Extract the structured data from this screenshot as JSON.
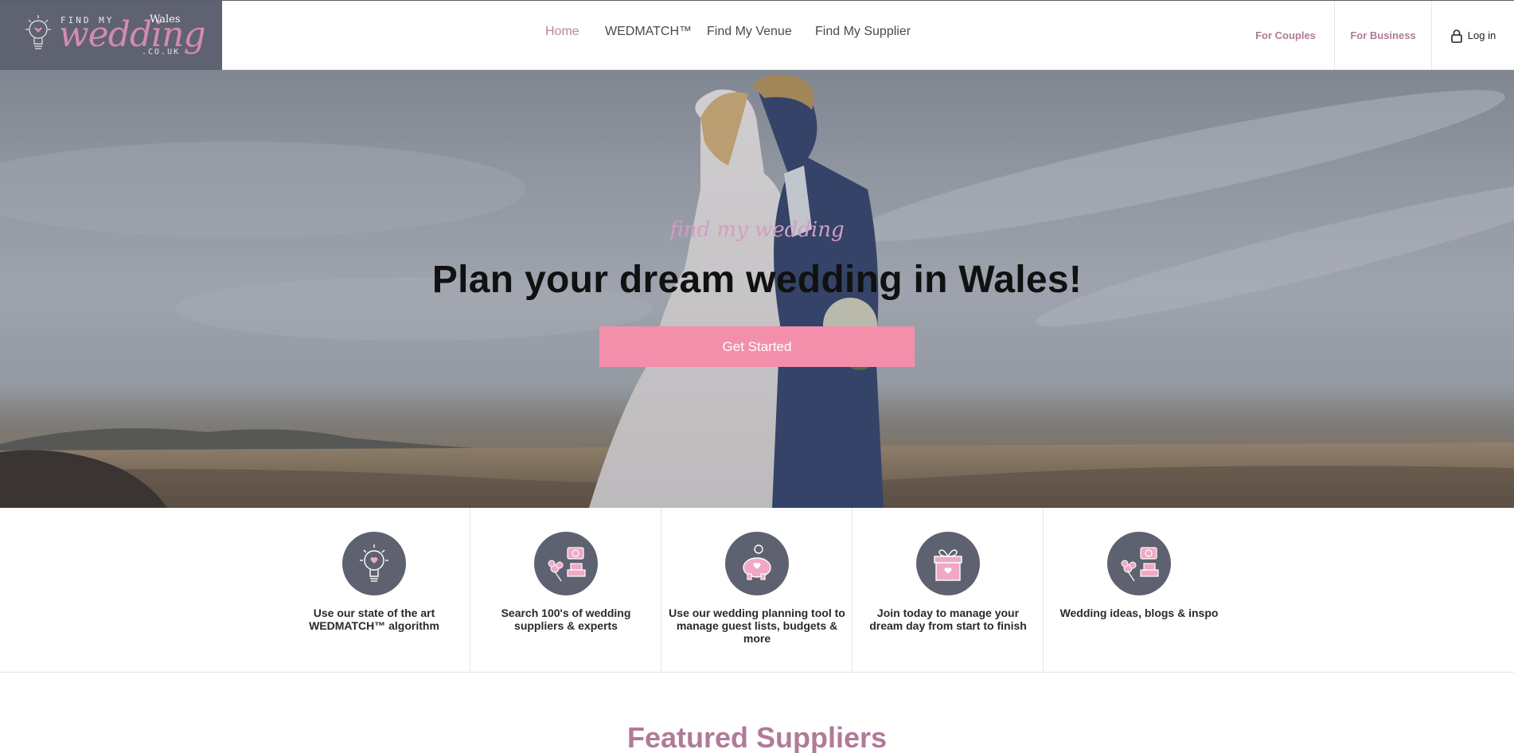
{
  "brand": {
    "logo_find": "FIND MY",
    "logo_wales": "Wales",
    "logo_wedding": "wedding",
    "logo_couk": ".CO.UK"
  },
  "nav": {
    "items": [
      "Home",
      "WEDMATCH™",
      "Find My Venue",
      "Find My Supplier"
    ]
  },
  "rightnav": {
    "couples": "For Couples",
    "business": "For Business",
    "login": "Log in"
  },
  "hero": {
    "script": "find my wedding",
    "title": "Plan your dream wedding in Wales!",
    "cta": "Get Started"
  },
  "features": [
    {
      "icon": "lightbulb-icon",
      "text": "Use our state of the art WEDMATCH™ algorithm"
    },
    {
      "icon": "camera-cake-icon",
      "text": "Search 100's of wedding suppliers & experts"
    },
    {
      "icon": "piggy-bank-icon",
      "text": "Use our wedding planning tool to manage guest lists, budgets & more"
    },
    {
      "icon": "gift-icon",
      "text": "Join today to manage your dream day from start to finish"
    },
    {
      "icon": "camera-cake-icon",
      "text": "Wedding ideas, blogs & inspo"
    }
  ],
  "featured": {
    "title": "Featured Suppliers"
  },
  "colors": {
    "accent_pink": "#f48fab",
    "brand_mauve": "#b07a98",
    "logo_bg": "#5f6270",
    "icon_circle": "#5e6270"
  }
}
